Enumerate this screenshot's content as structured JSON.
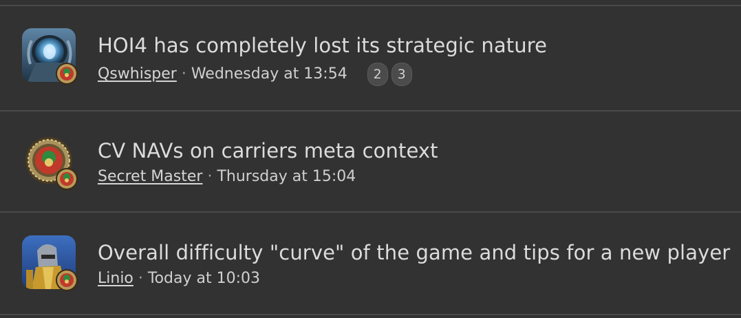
{
  "threads": [
    {
      "title": "HOI4 has completely lost its strategic nature",
      "author": "Qswhisper",
      "separator": "·",
      "date": "Wednesday at 13:54",
      "pages": [
        "2",
        "3"
      ],
      "avatar_icon": "portal-avatar-icon",
      "badge_icon": "medal-badge-icon"
    },
    {
      "title": "CV NAVs on carriers meta context",
      "author": "Secret Master",
      "separator": "·",
      "date": "Thursday at 15:04",
      "avatar_icon": "emblem-avatar-icon",
      "badge_icon": "medal-badge-icon"
    },
    {
      "title": "Overall difficulty \"curve\" of the game and tips for a new player",
      "author": "Linio",
      "separator": "·",
      "date": "Today at 10:03",
      "avatar_icon": "knight-avatar-icon",
      "badge_icon": "medal-badge-icon"
    }
  ],
  "colors": {
    "background": "#323232",
    "divider": "#4a4a4a",
    "title_text": "#dcdcdc",
    "meta_text": "#d0d0d0"
  }
}
